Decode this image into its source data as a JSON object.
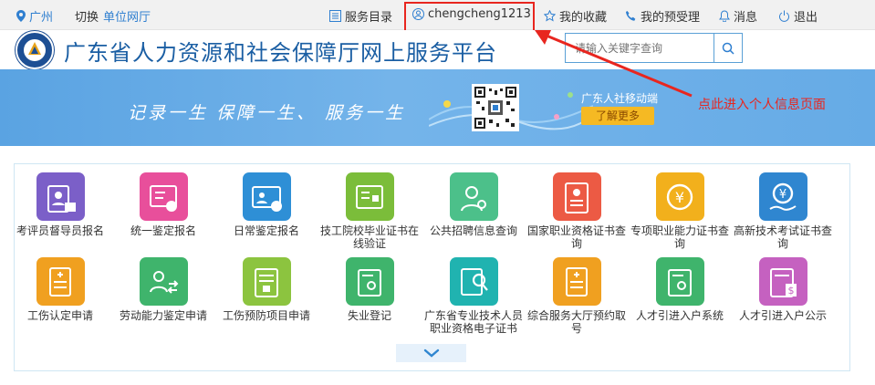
{
  "topbar": {
    "location": "广州",
    "switch": "切换",
    "unit_hall": "单位网厅",
    "service_dir": "服务目录",
    "username": "chengcheng1213",
    "favorites": "我的收藏",
    "appointment": "我的预受理",
    "messages": "消息",
    "logout": "退出"
  },
  "header": {
    "site_title": "广东省人力资源和社会保障厅网上服务平台",
    "search_placeholder": "请输入关键字查询"
  },
  "banner": {
    "slogan": "记录一生  保障一生、  服务一生",
    "mobile_label": "广东人社移动端",
    "learn_more": "了解更多"
  },
  "annotation": "点此进入个人信息页面",
  "services": [
    {
      "label": "考评员督导员报名",
      "icon": "person-card-icon",
      "color": "#7b5fc8"
    },
    {
      "label": "统一鉴定报名",
      "icon": "certificate-signup-icon",
      "color": "#e84f9b"
    },
    {
      "label": "日常鉴定报名",
      "icon": "id-card-edit-icon",
      "color": "#2e8fd6"
    },
    {
      "label": "技工院校毕业证书在线验证",
      "icon": "diploma-lock-icon",
      "color": "#7bbd3a"
    },
    {
      "label": "公共招聘信息查询",
      "icon": "recruit-search-icon",
      "color": "#4cc08a"
    },
    {
      "label": "国家职业资格证书查询",
      "icon": "qualification-doc-icon",
      "color": "#ec5a44"
    },
    {
      "label": "专项职业能力证书查询",
      "icon": "yen-coin-icon",
      "color": "#f2b01c"
    },
    {
      "label": "高新技术考试证书查询",
      "icon": "yen-hand-icon",
      "color": "#2f86d0"
    },
    {
      "label": "工伤认定申请",
      "icon": "document-plus-icon",
      "color": "#f0a020"
    },
    {
      "label": "劳动能力鉴定申请",
      "icon": "people-switch-icon",
      "color": "#3fb46c"
    },
    {
      "label": "工伤预防项目申请",
      "icon": "document-lock-icon",
      "color": "#8cc43f"
    },
    {
      "label": "失业登记",
      "icon": "person-list-icon",
      "color": "#3fb46c"
    },
    {
      "label": "广东省专业技术人员职业资格电子证书",
      "icon": "certificate-search-icon",
      "color": "#20b3b0"
    },
    {
      "label": "综合服务大厅预约取号",
      "icon": "ticket-number-icon",
      "color": "#f0a020"
    },
    {
      "label": "人才引进入户系统",
      "icon": "talent-person-icon",
      "color": "#3fb46c"
    },
    {
      "label": "人才引进入户公示",
      "icon": "notice-dollar-icon",
      "color": "#c561c0"
    }
  ]
}
